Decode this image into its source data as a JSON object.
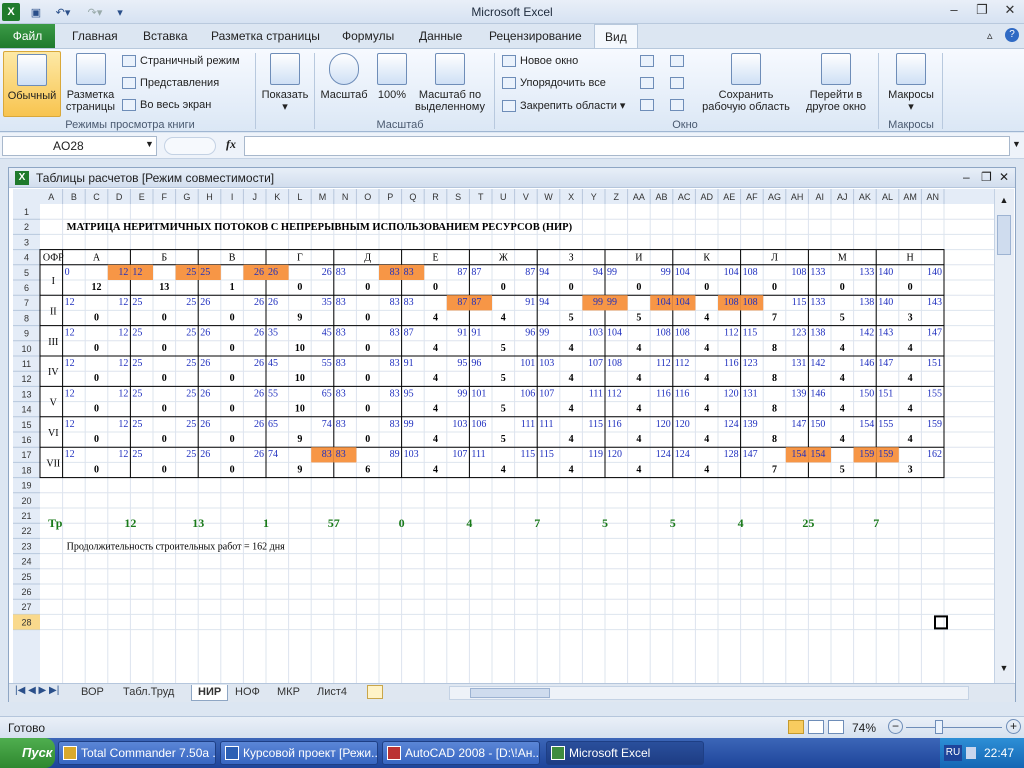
{
  "app": {
    "title": "Microsoft Excel"
  },
  "ribbon_tabs": [
    "Файл",
    "Главная",
    "Вставка",
    "Разметка страницы",
    "Формулы",
    "Данные",
    "Рецензирование",
    "Вид"
  ],
  "ribbon": {
    "normal": "Обычный",
    "page_layout_1": "Разметка",
    "page_layout_2": "страницы",
    "page_mode": "Страничный режим",
    "views": "Представления",
    "fullscreen": "Во весь экран",
    "group_views": "Режимы просмотра книги",
    "show": "Показать",
    "zoom": "Масштаб",
    "zoom100": "100%",
    "zoom_sel_1": "Масштаб по",
    "zoom_sel_2": "выделенному",
    "group_zoom": "Масштаб",
    "new_window": "Новое окно",
    "arrange_all": "Упорядочить все",
    "freeze": "Закрепить области",
    "save_ws_1": "Сохранить",
    "save_ws_2": "рабочую область",
    "switch_1": "Перейти в",
    "switch_2": "другое окно",
    "group_window": "Окно",
    "macros": "Макросы",
    "group_macros": "Макросы"
  },
  "formula_bar": {
    "name_box": "AO28",
    "fx": "fx",
    "formula": ""
  },
  "workbook": {
    "title": "Таблицы расчетов  [Режим совместимости]"
  },
  "sheet": {
    "columns": [
      "A",
      "B",
      "C",
      "D",
      "E",
      "F",
      "G",
      "H",
      "I",
      "J",
      "K",
      "L",
      "M",
      "N",
      "O",
      "P",
      "Q",
      "R",
      "S",
      "T",
      "U",
      "V",
      "W",
      "X",
      "Y",
      "Z",
      "AA",
      "AB",
      "AC",
      "AD",
      "AE",
      "AF",
      "AG",
      "AH",
      "AI",
      "AJ",
      "AK",
      "AL",
      "AM",
      "AN"
    ],
    "rows": [
      "1",
      "2",
      "3",
      "4",
      "5",
      "6",
      "7",
      "8",
      "9",
      "10",
      "11",
      "12",
      "13",
      "14",
      "15",
      "16",
      "17",
      "18",
      "19",
      "20",
      "21",
      "22",
      "23",
      "24",
      "25",
      "26",
      "27",
      "28"
    ],
    "title": "МАТРИЦА НЕРИТМИЧНЫХ ПОТОКОВ С НЕПРЕРЫВНЫМ ИСПОЛЬЗОВАНИЕМ РЕСУРСОВ (НИР)",
    "ofr": "ОФР",
    "headers": [
      "А",
      "Б",
      "В",
      "Г",
      "Д",
      "Е",
      "Ж",
      "З",
      "И",
      "К",
      "Л",
      "М",
      "Н"
    ],
    "row_labels": [
      "I",
      "II",
      "III",
      "IV",
      "V",
      "VI",
      "VII"
    ],
    "cells": [
      [
        [
          0,
          12,
          12
        ],
        [
          12,
          13,
          25
        ],
        [
          25,
          1,
          26
        ],
        [
          26,
          0,
          26
        ],
        [
          83,
          0,
          83
        ],
        [
          83,
          0,
          87
        ],
        [
          87,
          0,
          87
        ],
        [
          94,
          0,
          94
        ],
        [
          99,
          0,
          99
        ],
        [
          104,
          0,
          104
        ],
        [
          108,
          0,
          108
        ],
        [
          133,
          0,
          133
        ],
        [
          140,
          0,
          140
        ]
      ],
      [
        [
          12,
          0,
          12
        ],
        [
          25,
          0,
          25
        ],
        [
          26,
          0,
          26
        ],
        [
          26,
          9,
          35
        ],
        [
          83,
          0,
          83
        ],
        [
          83,
          4,
          87
        ],
        [
          87,
          4,
          91
        ],
        [
          94,
          5,
          99
        ],
        [
          99,
          5,
          104
        ],
        [
          104,
          4,
          108
        ],
        [
          108,
          7,
          115
        ],
        [
          133,
          5,
          138
        ],
        [
          140,
          3,
          143
        ]
      ],
      [
        [
          12,
          0,
          12
        ],
        [
          25,
          0,
          25
        ],
        [
          26,
          0,
          26
        ],
        [
          35,
          10,
          45
        ],
        [
          83,
          0,
          83
        ],
        [
          87,
          4,
          91
        ],
        [
          91,
          5,
          96
        ],
        [
          99,
          4,
          103
        ],
        [
          104,
          4,
          108
        ],
        [
          108,
          4,
          112
        ],
        [
          115,
          8,
          123
        ],
        [
          138,
          4,
          142
        ],
        [
          143,
          4,
          147
        ]
      ],
      [
        [
          12,
          0,
          12
        ],
        [
          25,
          0,
          25
        ],
        [
          26,
          0,
          26
        ],
        [
          45,
          10,
          55
        ],
        [
          83,
          0,
          83
        ],
        [
          91,
          4,
          95
        ],
        [
          96,
          5,
          101
        ],
        [
          103,
          4,
          107
        ],
        [
          108,
          4,
          112
        ],
        [
          112,
          4,
          116
        ],
        [
          123,
          8,
          131
        ],
        [
          142,
          4,
          146
        ],
        [
          147,
          4,
          151
        ]
      ],
      [
        [
          12,
          0,
          12
        ],
        [
          25,
          0,
          25
        ],
        [
          26,
          0,
          26
        ],
        [
          55,
          10,
          65
        ],
        [
          83,
          0,
          83
        ],
        [
          95,
          4,
          99
        ],
        [
          101,
          5,
          106
        ],
        [
          107,
          4,
          111
        ],
        [
          112,
          4,
          116
        ],
        [
          116,
          4,
          120
        ],
        [
          131,
          8,
          139
        ],
        [
          146,
          4,
          150
        ],
        [
          151,
          4,
          155
        ]
      ],
      [
        [
          12,
          0,
          12
        ],
        [
          25,
          0,
          25
        ],
        [
          26,
          0,
          26
        ],
        [
          65,
          9,
          74
        ],
        [
          83,
          0,
          83
        ],
        [
          99,
          4,
          103
        ],
        [
          106,
          5,
          111
        ],
        [
          111,
          4,
          115
        ],
        [
          116,
          4,
          120
        ],
        [
          120,
          4,
          124
        ],
        [
          139,
          8,
          147
        ],
        [
          150,
          4,
          154
        ],
        [
          155,
          4,
          159
        ]
      ],
      [
        [
          12,
          0,
          12
        ],
        [
          25,
          0,
          25
        ],
        [
          26,
          0,
          26
        ],
        [
          74,
          9,
          83
        ],
        [
          83,
          6,
          89
        ],
        [
          103,
          4,
          107
        ],
        [
          111,
          4,
          115
        ],
        [
          115,
          4,
          119
        ],
        [
          120,
          4,
          124
        ],
        [
          124,
          4,
          128
        ],
        [
          147,
          7,
          154
        ],
        [
          154,
          5,
          159
        ],
        [
          159,
          3,
          162
        ]
      ]
    ],
    "tp_label": "Тр",
    "tp_values": [
      "12",
      "13",
      "1",
      "57",
      "0",
      "4",
      "7",
      "5",
      "5",
      "4",
      "25",
      "7"
    ],
    "note": "Продолжительность строительных работ = 162 дня",
    "highlight_color": "#f79646"
  },
  "sheet_tabs": [
    "ВОР",
    "Табл.Труд",
    "НИР",
    "НОФ",
    "МКР",
    "Лист4"
  ],
  "active_sheet": "НИР",
  "status": {
    "ready": "Готово",
    "zoom": "74%"
  },
  "taskbar": {
    "start": "Пуск",
    "items": [
      "Total Commander 7.50a ...",
      "Курсовой проект [Режи...",
      "AutoCAD 2008 - [D:\\!Ан...",
      "Microsoft Excel"
    ],
    "lang": "RU",
    "time": "22:47"
  }
}
